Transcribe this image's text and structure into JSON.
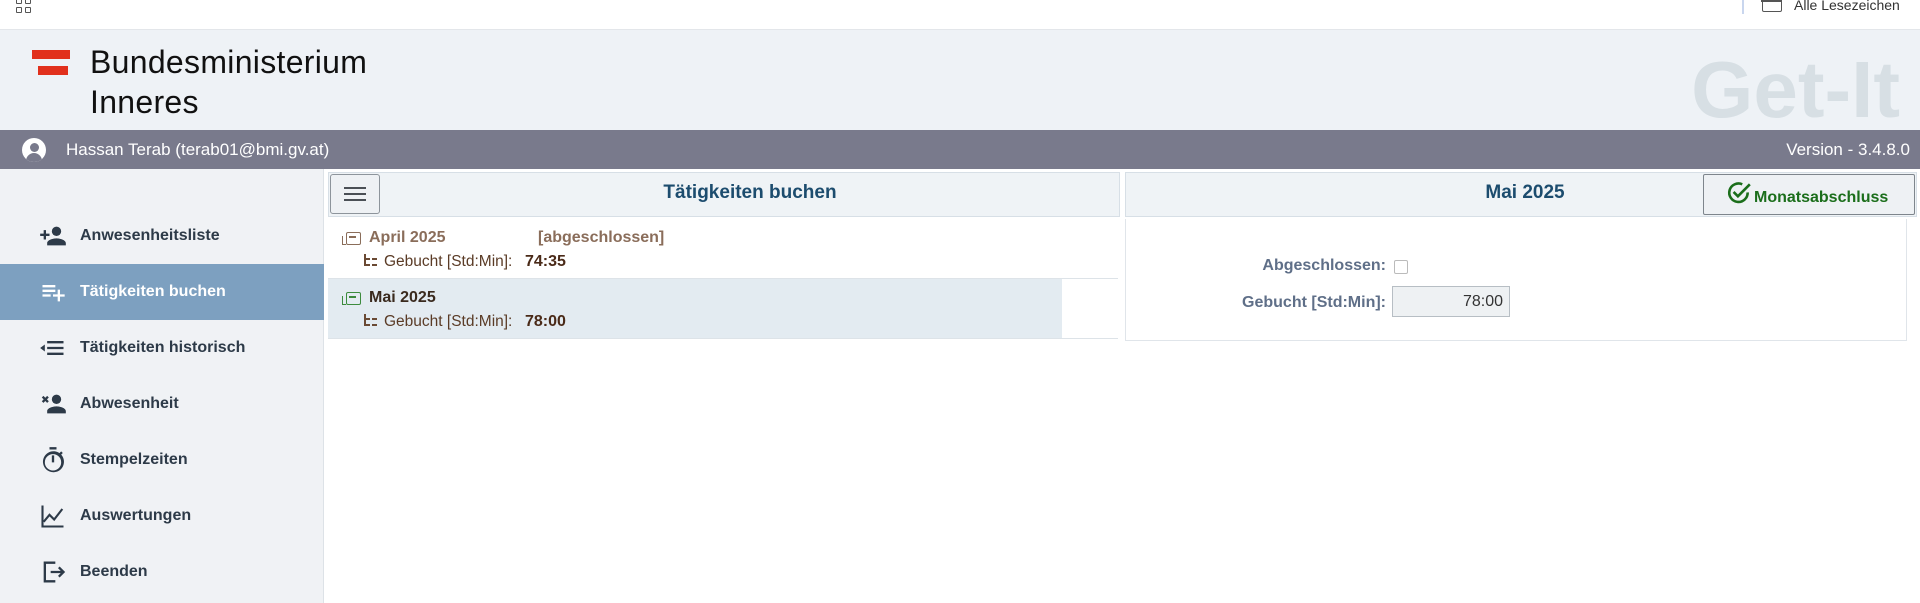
{
  "browser": {
    "bookmarks_all_label": "Alle Lesezeichen"
  },
  "header": {
    "ministry_line1": "Bundesministerium",
    "ministry_line2": "Inneres",
    "app_name": "Get-It",
    "flag_color": "#e1301c"
  },
  "user_bar": {
    "user_name": "Hassan Terab (terab01@bmi.gv.at)",
    "version": "Version - 3.4.8.0"
  },
  "sidebar": {
    "items": [
      {
        "label": "Anwesenheitsliste",
        "icon": "person-add-icon",
        "active": false
      },
      {
        "label": "Tätigkeiten buchen",
        "icon": "playlist-add-icon",
        "active": true
      },
      {
        "label": "Tätigkeiten historisch",
        "icon": "history-list-icon",
        "active": false
      },
      {
        "label": "Abwesenheit",
        "icon": "person-remove-icon",
        "active": false
      },
      {
        "label": "Stempelzeiten",
        "icon": "stopwatch-icon",
        "active": false
      },
      {
        "label": "Auswertungen",
        "icon": "chart-line-icon",
        "active": false
      },
      {
        "label": "Beenden",
        "icon": "logout-icon",
        "active": false
      }
    ]
  },
  "left_panel": {
    "title": "Tätigkeiten buchen",
    "months": [
      {
        "label": "April 2025",
        "status": "[abgeschlossen]",
        "booked_label": "Gebucht [Std:Min]:",
        "booked_value": "74:35",
        "color": "#8a6d5a",
        "selected": false
      },
      {
        "label": "Mai 2025",
        "status": "",
        "booked_label": "Gebucht [Std:Min]:",
        "booked_value": "78:00",
        "color": "#3d8b3d",
        "selected": true
      }
    ]
  },
  "right_panel": {
    "title": "Mai 2025",
    "close_button_label": "Monatsabschluss",
    "closed_label": "Abgeschlossen:",
    "closed_checked": false,
    "booked_label": "Gebucht [Std:Min]:",
    "booked_value": "78:00"
  }
}
